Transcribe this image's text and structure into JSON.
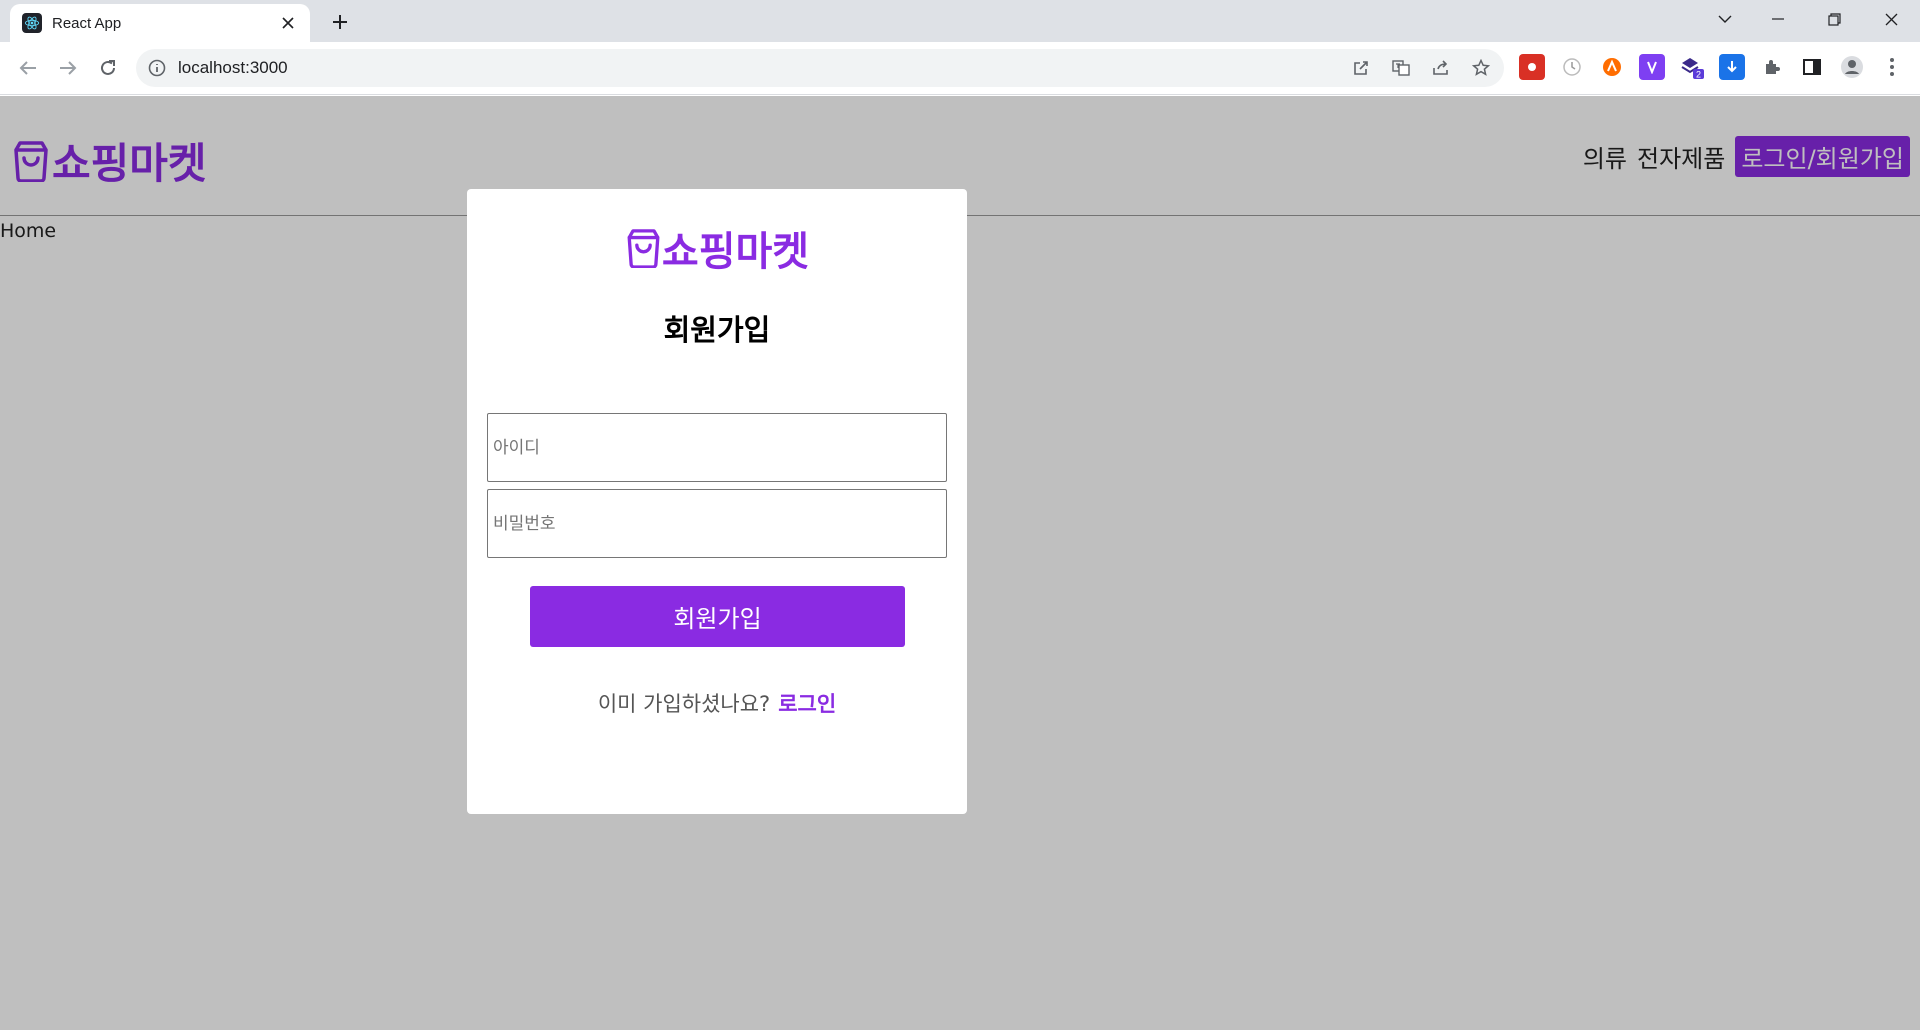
{
  "browser": {
    "tab_title": "React App",
    "url": "localhost:3000",
    "extension_badge": "2"
  },
  "site": {
    "brand": "쇼핑마켓",
    "nav": {
      "clothing": "의류",
      "electronics": "전자제품",
      "login_signup": "로그인/회원가입"
    },
    "breadcrumb": "Home"
  },
  "modal": {
    "brand": "쇼핑마켓",
    "title": "회원가입",
    "id_placeholder": "아이디",
    "password_placeholder": "비밀번호",
    "submit_label": "회원가입",
    "login_prompt": "이미 가입하셨나요?",
    "login_link": "로그인"
  },
  "colors": {
    "accent": "#8a2be2",
    "overlay": "rgba(0,0,0,0.25)",
    "tabbar": "#dee1e6"
  }
}
